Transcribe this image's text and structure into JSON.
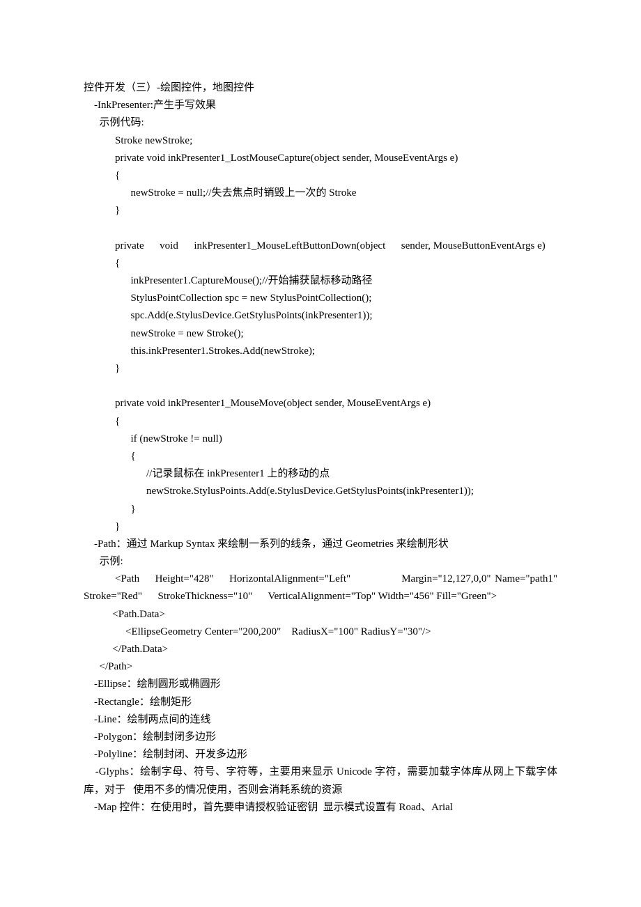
{
  "lines": [
    "控件开发（三）-绘图控件，地图控件",
    "    -InkPresenter:产生手写效果",
    "      示例代码:",
    "            Stroke newStroke;",
    "            private void inkPresenter1_LostMouseCapture(object sender, MouseEventArgs e)",
    "            {",
    "                  newStroke = null;//失去焦点时销毁上一次的 Stroke",
    "            }",
    "",
    "            private      void      inkPresenter1_MouseLeftButtonDown(object      sender, MouseButtonEventArgs e)",
    "            {",
    "                  inkPresenter1.CaptureMouse();//开始捕获鼠标移动路径",
    "                  StylusPointCollection spc = new StylusPointCollection();",
    "                  spc.Add(e.StylusDevice.GetStylusPoints(inkPresenter1));",
    "                  newStroke = new Stroke();",
    "                  this.inkPresenter1.Strokes.Add(newStroke);",
    "            }",
    "",
    "            private void inkPresenter1_MouseMove(object sender, MouseEventArgs e)",
    "            {",
    "                  if (newStroke != null)",
    "                  {",
    "                        //记录鼠标在 inkPresenter1 上的移动的点",
    "                        newStroke.StylusPoints.Add(e.StylusDevice.GetStylusPoints(inkPresenter1));",
    "                  }",
    "            }",
    "    -Path：通过 Markup Syntax 来绘制一系列的线条，通过 Geometries 来绘制形状",
    "      示例:",
    "        <Path    Height=\"428\"    HorizontalAlignment=\"Left\"             Margin=\"12,127,0,0\" Name=\"path1\"      Stroke=\"Red\"      StrokeThickness=\"10\"      VerticalAlignment=\"Top\" Width=\"456\" Fill=\"Green\">",
    "           <Path.Data>",
    "                <EllipseGeometry Center=\"200,200\"    RadiusX=\"100\" RadiusY=\"30\"/>",
    "           </Path.Data>",
    "      </Path>",
    "    -Ellipse：绘制圆形或椭圆形",
    "    -Rectangle：绘制矩形",
    "    -Line：绘制两点间的连线",
    "    -Polygon：绘制封闭多边形",
    "    -Polyline：绘制封闭、开发多边形",
    "    -Glyphs：绘制字母、符号、字符等，主要用来显示 Unicode 字符，需要加载字体库从网上下载字体库，对于   使用不多的情况使用，否则会消耗系统的资源",
    "    -Map 控件：在使用时，首先要申请授权验证密钥  显示模式设置有 Road、Arial"
  ]
}
